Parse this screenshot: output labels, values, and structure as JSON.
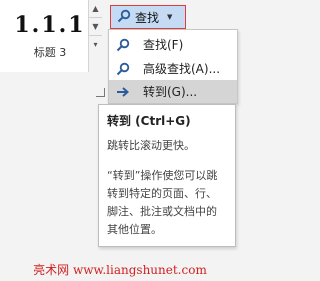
{
  "style_gallery": {
    "style_number": "1.1.1",
    "style_name": "标题 3"
  },
  "find_button": {
    "label": "查找",
    "icon": "search-icon"
  },
  "find_menu": {
    "items": [
      {
        "label": "查找(F)",
        "icon": "search-icon"
      },
      {
        "label": "高级查找(A)...",
        "icon": "search-icon"
      },
      {
        "label": "转到(G)...",
        "icon": "arrow-right-icon",
        "highlighted": true
      }
    ]
  },
  "tooltip": {
    "title": "转到 (Ctrl+G)",
    "description": "跳转比滚动更快。",
    "body": "“转到”操作使您可以跳转到特定的页面、行、脚注、批注或文档中的其他位置。"
  },
  "watermark": "亮术网 www.liangshunet.com",
  "colors": {
    "highlight_border": "#e03c3c",
    "button_bg": "#c5dbf3",
    "menu_hover": "#d5d5d5",
    "watermark": "#d21f1f"
  }
}
